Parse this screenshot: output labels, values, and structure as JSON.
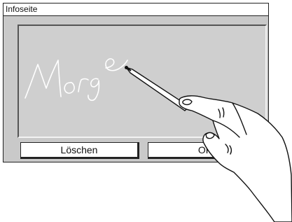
{
  "window": {
    "title": "Infoseite"
  },
  "signature_pad": {
    "handwritten_text": "Morge"
  },
  "buttons": {
    "clear_label": "Löschen",
    "ok_label": "OK"
  },
  "colors": {
    "window_background": "#c9c9c9",
    "border": "#222222",
    "button_background": "#ffffff"
  },
  "icons": [
    "stylus-pen-icon",
    "hand-illustration"
  ]
}
